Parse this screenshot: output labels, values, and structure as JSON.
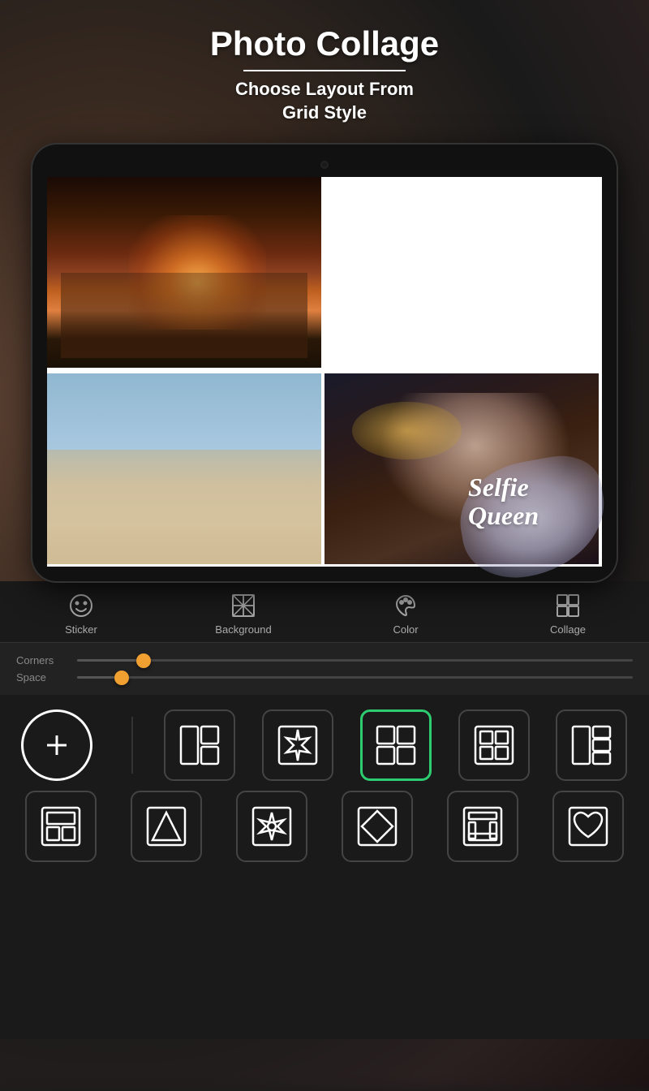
{
  "header": {
    "title": "Photo Collage",
    "subtitle": "Choose Layout From\nGrid Style"
  },
  "tabs": [
    {
      "id": "sticker",
      "label": "Sticker"
    },
    {
      "id": "background",
      "label": "Background"
    },
    {
      "id": "color",
      "label": "Color"
    },
    {
      "id": "collage",
      "label": "Collage"
    }
  ],
  "sliders": [
    {
      "label": "Corners",
      "value": 0.12
    },
    {
      "label": "Space",
      "value": 0.08
    }
  ],
  "selfie_sticker": {
    "line1": "Selfie",
    "line2": "Queen"
  },
  "layouts": {
    "add_label": "+",
    "active_index": 3
  },
  "colors": {
    "accent": "#2ecc71",
    "slider_thumb": "#f0a030",
    "tab_text": "#aaaaaa",
    "bg_dark": "#1a1a1a"
  }
}
